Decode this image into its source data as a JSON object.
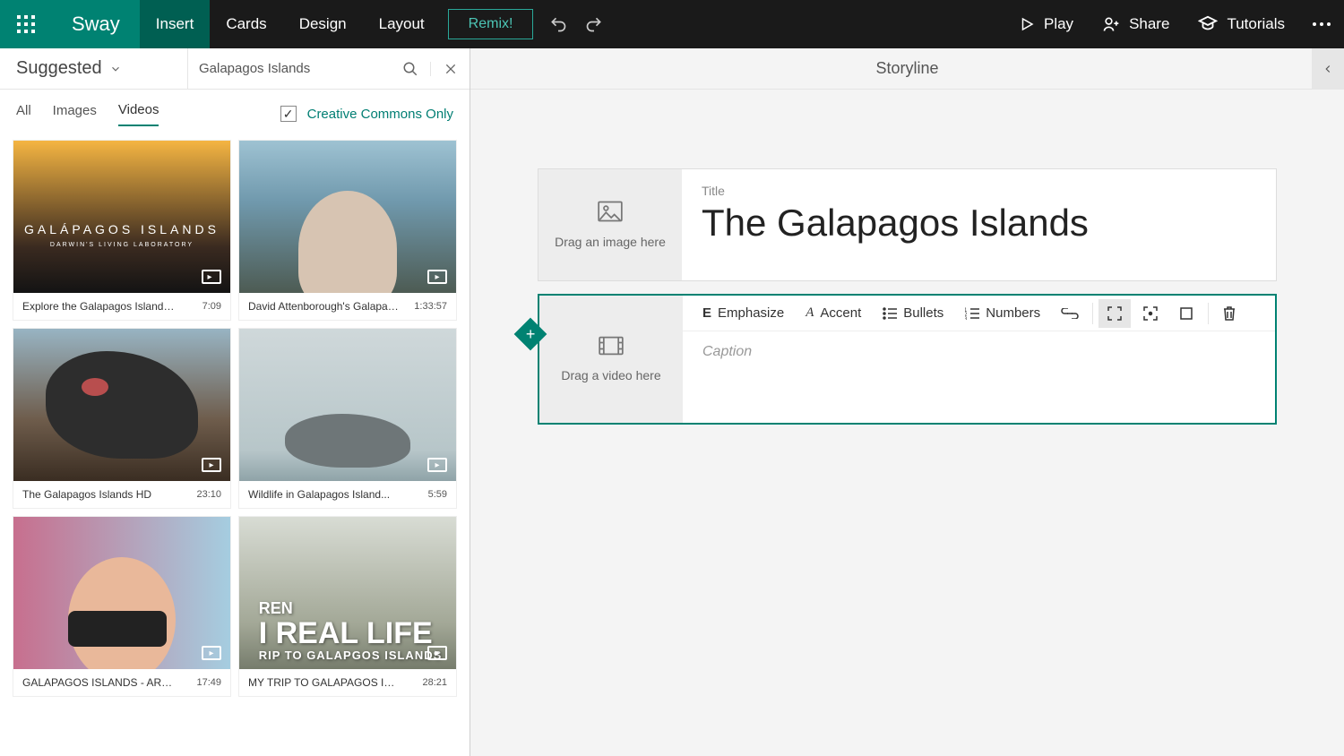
{
  "topbar": {
    "app_name": "Sway",
    "menu": {
      "insert": "Insert",
      "cards": "Cards",
      "design": "Design",
      "layout": "Layout",
      "remix": "Remix!"
    },
    "right": {
      "play": "Play",
      "share": "Share",
      "tutorials": "Tutorials"
    }
  },
  "left": {
    "source_label": "Suggested",
    "search_value": "Galapagos Islands",
    "tabs": {
      "all": "All",
      "images": "Images",
      "videos": "Videos"
    },
    "cc_label": "Creative Commons Only",
    "results": [
      {
        "title": "Explore the Galapagos Islands with ...",
        "duration": "7:09",
        "overlay1": "GALÁPAGOS ISLANDS",
        "overlay2": "DARWIN'S LIVING LABORATORY"
      },
      {
        "title": "David Attenborough's Galapagos...",
        "duration": "1:33:57"
      },
      {
        "title": "The Galapagos Islands HD",
        "duration": "23:10"
      },
      {
        "title": "Wildlife in Galapagos Island...",
        "duration": "5:59"
      },
      {
        "title": "GALAPAGOS ISLANDS - ARE THEY...",
        "duration": "17:49"
      },
      {
        "title": "MY TRIP TO GALAPAGOS ISLANDS...",
        "duration": "28:21",
        "o1": "REN",
        "o2": "I REAL LIFE",
        "o3": "RIP TO GALAPGOS ISLANDS"
      }
    ]
  },
  "storyline": {
    "header": "Storyline",
    "title_card": {
      "label": "Title",
      "text": "The Galapagos Islands",
      "drop_hint": "Drag an image here"
    },
    "video_card": {
      "drop_hint": "Drag a video here",
      "caption_placeholder": "Caption",
      "tools": {
        "emphasize": "Emphasize",
        "accent": "Accent",
        "bullets": "Bullets",
        "numbers": "Numbers"
      }
    }
  }
}
